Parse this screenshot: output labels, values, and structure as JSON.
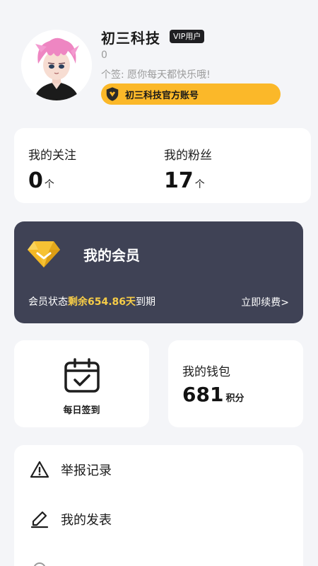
{
  "profile": {
    "username": "初三科技",
    "vip_badge": "VIP用户",
    "user_number": "0",
    "signature": "个签: 愿你每天都快乐哦!",
    "official_badge": "初三科技官方账号"
  },
  "stats": {
    "follow_label": "我的关注",
    "follow_value": "0",
    "follow_unit": "个",
    "fans_label": "我的粉丝",
    "fans_value": "17",
    "fans_unit": "个"
  },
  "membership": {
    "title": "我的会员",
    "status_prefix": "会员状态",
    "status_remaining": "剩余654.86天",
    "status_suffix": "到期",
    "renew_label": "立即续费>",
    "colors": {
      "card": "#3f4255",
      "highlight": "#f6cc47"
    }
  },
  "checkin": {
    "label": "每日签到"
  },
  "wallet": {
    "title": "我的钱包",
    "value": "681",
    "unit": "积分"
  },
  "menu": {
    "items": [
      {
        "label": "举报记录",
        "icon": "warning-icon"
      },
      {
        "label": "我的发表",
        "icon": "pencil-icon"
      },
      {
        "label": "",
        "icon": "item-icon"
      }
    ]
  },
  "colors": {
    "background": "#f4f5f8",
    "accent": "#fbb829",
    "card": "#ffffff"
  }
}
